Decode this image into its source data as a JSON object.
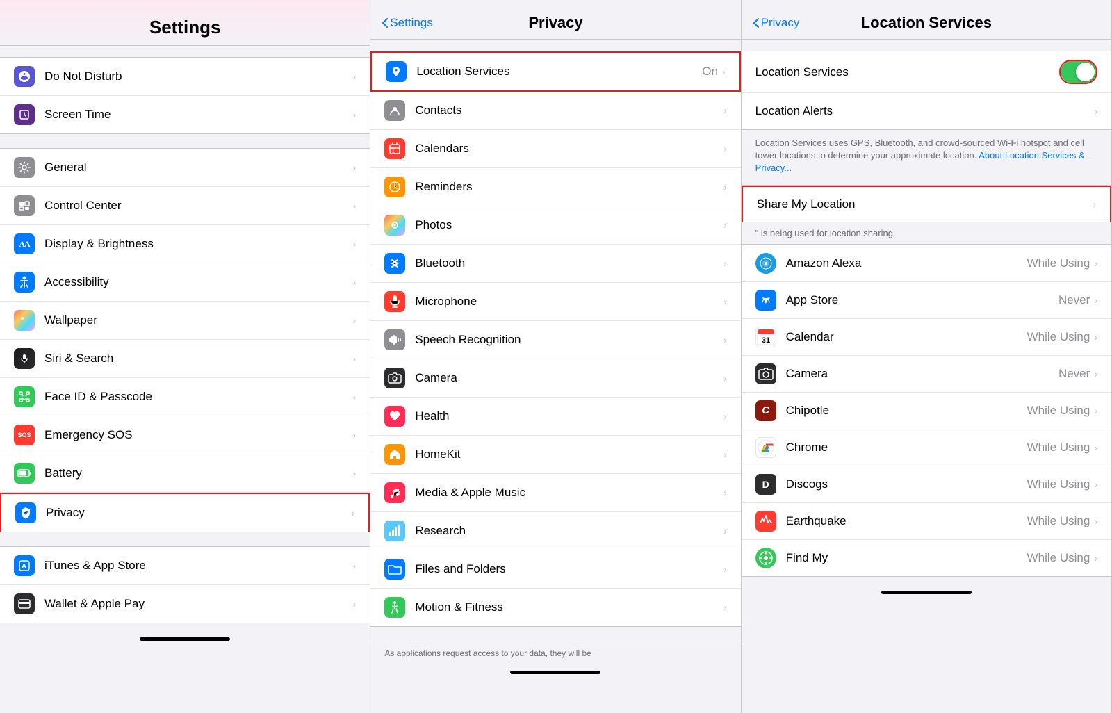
{
  "panel1": {
    "title": "Settings",
    "items_top": [
      {
        "id": "do-not-disturb",
        "label": "Do Not Disturb",
        "icon_bg": "#5856d6",
        "icon": "🌙"
      },
      {
        "id": "screen-time",
        "label": "Screen Time",
        "icon_bg": "#5e2f89",
        "icon": "⏳"
      }
    ],
    "items_middle": [
      {
        "id": "general",
        "label": "General",
        "icon_bg": "#8e8e93",
        "icon": "⚙️"
      },
      {
        "id": "control-center",
        "label": "Control Center",
        "icon_bg": "#8e8e93",
        "icon": "☰"
      },
      {
        "id": "display-brightness",
        "label": "Display & Brightness",
        "icon_bg": "#007aff",
        "icon": "AA"
      },
      {
        "id": "accessibility",
        "label": "Accessibility",
        "icon_bg": "#007aff",
        "icon": "♿"
      },
      {
        "id": "wallpaper",
        "label": "Wallpaper",
        "icon_bg": "#34aadc",
        "icon": "🌸"
      },
      {
        "id": "siri-search",
        "label": "Siri & Search",
        "icon_bg": "#2c2c2e",
        "icon": "🎤"
      },
      {
        "id": "face-id",
        "label": "Face ID & Passcode",
        "icon_bg": "#34c759",
        "icon": "👤"
      },
      {
        "id": "emergency-sos",
        "label": "Emergency SOS",
        "icon_bg": "#ff3b30",
        "icon": "SOS"
      },
      {
        "id": "battery",
        "label": "Battery",
        "icon_bg": "#34c759",
        "icon": "🔋"
      },
      {
        "id": "privacy",
        "label": "Privacy",
        "icon_bg": "#007aff",
        "icon": "✋",
        "highlighted": true
      }
    ],
    "items_bottom": [
      {
        "id": "itunes-app-store",
        "label": "iTunes & App Store",
        "icon_bg": "#007aff",
        "icon": "🅰"
      },
      {
        "id": "wallet-apple-pay",
        "label": "Wallet & Apple Pay",
        "icon_bg": "#2c2c2e",
        "icon": "💳"
      }
    ]
  },
  "panel2": {
    "back_label": "Settings",
    "title": "Privacy",
    "items": [
      {
        "id": "location-services",
        "label": "Location Services",
        "value": "On",
        "icon_bg": "#007aff",
        "icon": "📍",
        "highlighted": true
      },
      {
        "id": "contacts",
        "label": "Contacts",
        "icon_bg": "#8e8e93",
        "icon": "👤"
      },
      {
        "id": "calendars",
        "label": "Calendars",
        "icon_bg": "#ff3b30",
        "icon": "📅"
      },
      {
        "id": "reminders",
        "label": "Reminders",
        "icon_bg": "#ff9500",
        "icon": "🔔"
      },
      {
        "id": "photos",
        "label": "Photos",
        "icon_bg": "linear",
        "icon": "🌈"
      },
      {
        "id": "bluetooth",
        "label": "Bluetooth",
        "icon_bg": "#007aff",
        "icon": "⬡"
      },
      {
        "id": "microphone",
        "label": "Microphone",
        "icon_bg": "#ff3b30",
        "icon": "🎙"
      },
      {
        "id": "speech-recognition",
        "label": "Speech Recognition",
        "icon_bg": "#8e8e93",
        "icon": "🎚"
      },
      {
        "id": "camera",
        "label": "Camera",
        "icon_bg": "#2c2c2e",
        "icon": "📷"
      },
      {
        "id": "health",
        "label": "Health",
        "icon_bg": "#ff3b30",
        "icon": "❤"
      },
      {
        "id": "homekit",
        "label": "HomeKit",
        "icon_bg": "#ff9500",
        "icon": "🏠"
      },
      {
        "id": "media-apple-music",
        "label": "Media & Apple Music",
        "icon_bg": "#ff2d55",
        "icon": "🎵"
      },
      {
        "id": "research",
        "label": "Research",
        "icon_bg": "#5ac8fa",
        "icon": "📊"
      },
      {
        "id": "files-folders",
        "label": "Files and Folders",
        "icon_bg": "#007aff",
        "icon": "📁"
      },
      {
        "id": "motion-fitness",
        "label": "Motion & Fitness",
        "icon_bg": "#34c759",
        "icon": "🏃"
      }
    ],
    "footer_note": "As applications request access to your data, they will be"
  },
  "panel3": {
    "back_label": "Privacy",
    "title": "Location Services",
    "location_services_label": "Location Services",
    "location_alerts_label": "Location Alerts",
    "info_text": "Location Services uses GPS, Bluetooth, and crowd-sourced Wi-Fi hotspot and cell tower locations to determine your approximate location.",
    "info_link": "About Location Services & Privacy...",
    "share_my_location_label": "Share My Location",
    "sharing_note": "\" is being used for location sharing.",
    "apps": [
      {
        "id": "amazon-alexa",
        "label": "Amazon Alexa",
        "permission": "While Using",
        "icon_bg": "#1a9ae1",
        "icon": "A"
      },
      {
        "id": "app-store",
        "label": "App Store",
        "permission": "Never",
        "icon_bg": "#007aff",
        "icon": "A"
      },
      {
        "id": "calendar",
        "label": "Calendar",
        "permission": "While Using",
        "icon_bg": "#ff3b30",
        "icon": "📅"
      },
      {
        "id": "camera",
        "label": "Camera",
        "permission": "Never",
        "icon_bg": "#2c2c2e",
        "icon": "📷"
      },
      {
        "id": "chipotle",
        "label": "Chipotle",
        "permission": "While Using",
        "icon_bg": "#8b1a0d",
        "icon": "C"
      },
      {
        "id": "chrome",
        "label": "Chrome",
        "permission": "While Using",
        "icon_bg": "#4285f4",
        "icon": "G"
      },
      {
        "id": "discogs",
        "label": "Discogs",
        "permission": "While Using",
        "icon_bg": "#2d2d2d",
        "icon": "D"
      },
      {
        "id": "earthquake",
        "label": "Earthquake",
        "permission": "While Using",
        "icon_bg": "#ff3b30",
        "icon": "E"
      },
      {
        "id": "find-my",
        "label": "Find My",
        "permission": "While Using",
        "icon_bg": "#34c759",
        "icon": "F"
      }
    ]
  },
  "colors": {
    "highlight_red": "#e02020",
    "toggle_on": "#34c759",
    "chevron": "#c7c7cc",
    "back_blue": "#007aff"
  },
  "icons": {
    "chevron_right": "›",
    "chevron_left": "‹"
  }
}
